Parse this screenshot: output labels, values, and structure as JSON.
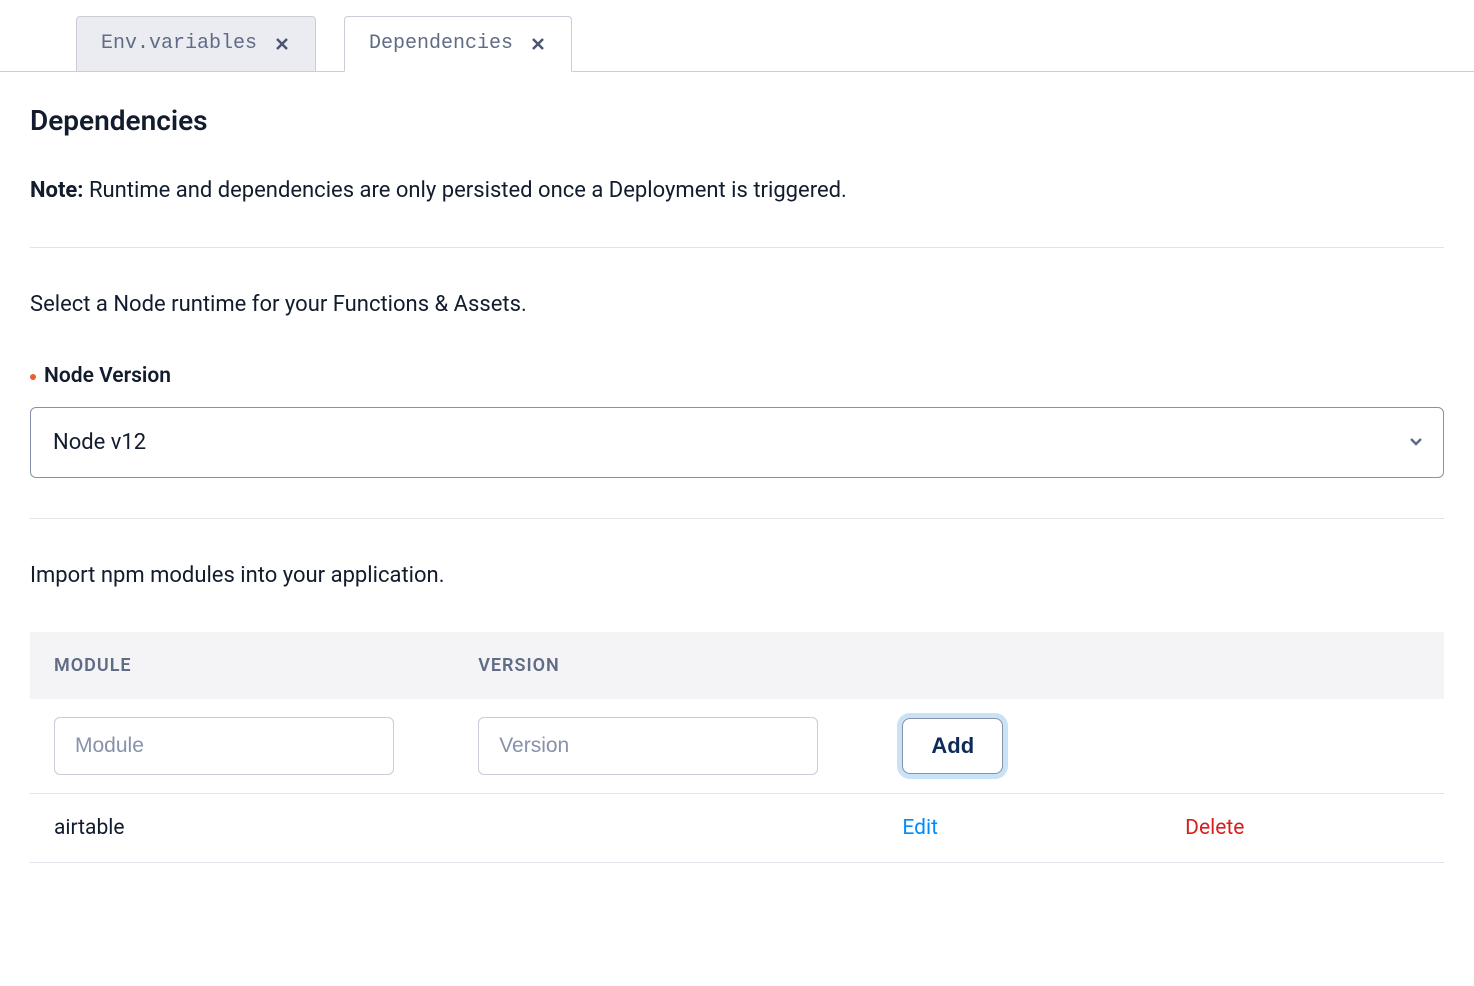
{
  "tabs": [
    {
      "label": "Env.variables",
      "active": false
    },
    {
      "label": "Dependencies",
      "active": true
    }
  ],
  "page": {
    "title": "Dependencies",
    "note_label": "Note:",
    "note_text": "Runtime and dependencies are only persisted once a Deployment is triggered.",
    "runtime_intro": "Select a Node runtime for your Functions & Assets.",
    "node_version_label": "Node Version",
    "node_version_value": "Node v12",
    "modules_intro": "Import npm modules into your application."
  },
  "table": {
    "headers": {
      "module": "MODULE",
      "version": "VERSION"
    },
    "inputs": {
      "module_placeholder": "Module",
      "version_placeholder": "Version",
      "add_label": "Add"
    },
    "rows": [
      {
        "module": "airtable",
        "version": "",
        "edit_label": "Edit",
        "delete_label": "Delete"
      }
    ]
  }
}
